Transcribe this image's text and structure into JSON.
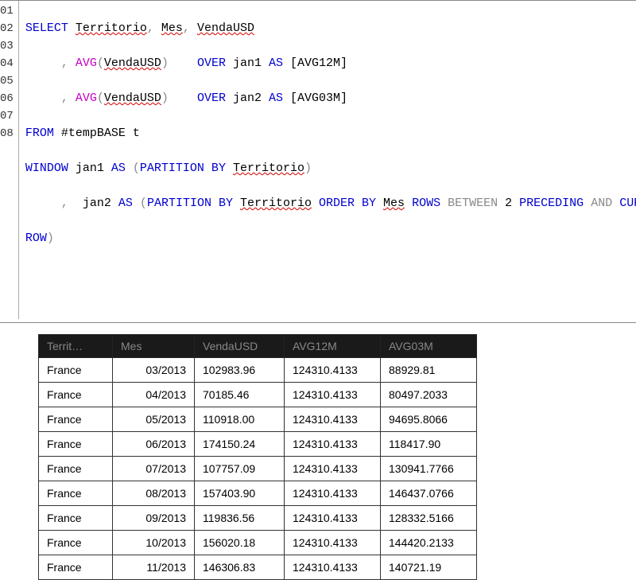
{
  "code": {
    "lines": [
      "01",
      "02",
      "03",
      "04",
      "05",
      "06",
      "07",
      "08"
    ],
    "kw_select": "SELECT",
    "territorio": "Territorio",
    "mes": "Mes",
    "vendausd": "VendaUSD",
    "avg": "AVG",
    "over": "OVER",
    "jan1": "jan1",
    "jan2": "jan2",
    "as": "AS",
    "avg12": "[AVG12M]",
    "avg03": "[AVG03M]",
    "from": "FROM",
    "tempbase": "#tempBASE t",
    "window": "WINDOW",
    "partitionby": "PARTITION BY",
    "orderby": "ORDER BY",
    "rows": "ROWS",
    "between": "BETWEEN",
    "two": "2",
    "preceding": "PRECEDING",
    "and": "AND",
    "current": "CURRENT",
    "row": "ROW"
  },
  "table": {
    "headers": [
      "Territ…",
      "Mes",
      "VendaUSD",
      "AVG12M",
      "AVG03M"
    ],
    "rows": [
      [
        "France",
        "03/2013",
        "102983.96",
        "124310.4133",
        "88929.81"
      ],
      [
        "France",
        "04/2013",
        "70185.46",
        "124310.4133",
        "80497.2033"
      ],
      [
        "France",
        "05/2013",
        "110918.00",
        "124310.4133",
        "94695.8066"
      ],
      [
        "France",
        "06/2013",
        "174150.24",
        "124310.4133",
        "118417.90"
      ],
      [
        "France",
        "07/2013",
        "107757.09",
        "124310.4133",
        "130941.7766"
      ],
      [
        "France",
        "08/2013",
        "157403.90",
        "124310.4133",
        "146437.0766"
      ],
      [
        "France",
        "09/2013",
        "119836.56",
        "124310.4133",
        "128332.5166"
      ],
      [
        "France",
        "10/2013",
        "156020.18",
        "124310.4133",
        "144420.2133"
      ],
      [
        "France",
        "11/2013",
        "146306.83",
        "124310.4133",
        "140721.19"
      ]
    ]
  }
}
